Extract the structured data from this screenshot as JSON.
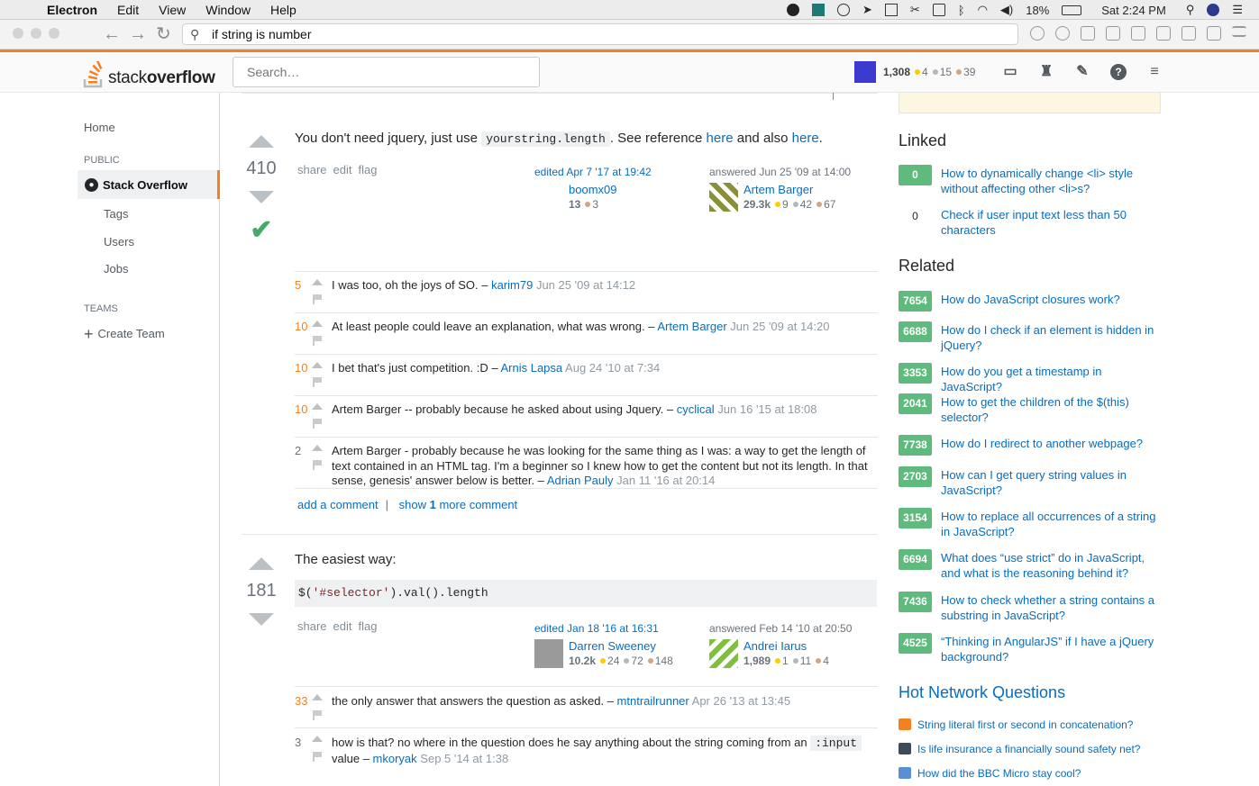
{
  "menubar": {
    "app": "Electron",
    "items": [
      "Edit",
      "View",
      "Window",
      "Help"
    ],
    "battery": "18%",
    "clock": "Sat 2:24 PM"
  },
  "browser": {
    "url": "if string is number"
  },
  "header": {
    "logo_light": "stack",
    "logo_bold": "overflow",
    "search_placeholder": "Search…",
    "reputation": "1,308",
    "gold": "4",
    "silver": "15",
    "bronze": "39"
  },
  "leftnav": {
    "home": "Home",
    "public_label": "PUBLIC",
    "stack_overflow": "Stack Overflow",
    "tags": "Tags",
    "users": "Users",
    "jobs": "Jobs",
    "teams_label": "TEAMS",
    "create_team": "Create Team"
  },
  "answers": [
    {
      "score": "410",
      "accepted": true,
      "body_pre": "You don't need jquery, just use",
      "body_code": "yourstring.length",
      "body_mid": ". See reference",
      "link1": "here",
      "body_and": "and also",
      "link2": "here",
      "body_end": ".",
      "menu": [
        "share",
        "edit",
        "flag"
      ],
      "edited": "edited Apr 7 '17 at 19:42",
      "editor": {
        "name": "boomx09",
        "rep": "13",
        "bronze": "3"
      },
      "answered": "answered Jun 25 '09 at 14:00",
      "author": {
        "name": "Artem Barger",
        "rep": "29.3k",
        "gold": "9",
        "silver": "42",
        "bronze": "67"
      },
      "comments": [
        {
          "score": "5",
          "text": "I was too, oh the joys of SO. –",
          "user": "karim79",
          "date": "Jun 25 '09 at 14:12"
        },
        {
          "score": "10",
          "text": "At least people could leave an explanation, what was wrong. –",
          "user": "Artem Barger",
          "date": "Jun 25 '09 at 14:20"
        },
        {
          "score": "10",
          "text": "I bet that's just competition. :D –",
          "user": "Arnis Lapsa",
          "date": "Aug 24 '10 at 7:34"
        },
        {
          "score": "10",
          "text": "Artem Barger -- probably because he asked about using Jquery. –",
          "user": "cyclical",
          "date": "Jun 16 '15 at 18:08"
        },
        {
          "score": "2",
          "text": "Artem Barger - probably because he was looking for the same thing as I was: a way to get the length of text contained in an HTML tag. I'm a beginner so I knew how to get the content but not its length. In that sense, genesis' answer below is better. –",
          "user": "Adrian Pauly",
          "date": "Jan 11 '16 at 20:14"
        }
      ],
      "add_comment": "add a comment",
      "show_more_pre": "show",
      "show_more_count": "1",
      "show_more_post": "more comment"
    },
    {
      "score": "181",
      "body": "The easiest way:",
      "code_pre": "$(",
      "code_str": "'#selector'",
      "code_post": ").val().length",
      "menu": [
        "share",
        "edit",
        "flag"
      ],
      "edited": "edited Jan 18 '16 at 16:31",
      "editor": {
        "name": "Darren Sweeney",
        "rep": "10.2k",
        "gold": "24",
        "silver": "72",
        "bronze": "148"
      },
      "answered": "answered Feb 14 '10 at 20:50",
      "author": {
        "name": "Andrei Iarus",
        "rep": "1,989",
        "gold": "1",
        "silver": "11",
        "bronze": "4"
      },
      "comments": [
        {
          "score": "33",
          "text": "the only answer that answers the question as asked. –",
          "user": "mtntrailrunner",
          "date": "Apr 26 '13 at 13:45"
        },
        {
          "score": "3",
          "text_pre": "how is that? no where in the question does he say anything about the string coming from an",
          "code": ":input",
          "text_post": "value –",
          "user": "mkoryak",
          "date": "Sep 5 '14 at 1:38"
        }
      ]
    }
  ],
  "sidebar": {
    "linked_title": "Linked",
    "linked": [
      {
        "count": "0",
        "title": "How to dynamically change <li> style without affecting other <li>s?"
      },
      {
        "count": "0",
        "title": "Check if user input text less than 50 characters"
      }
    ],
    "related_title": "Related",
    "related": [
      {
        "count": "7654",
        "title": "How do JavaScript closures work?"
      },
      {
        "count": "6688",
        "title": "How do I check if an element is hidden in jQuery?"
      },
      {
        "count": "3353",
        "title": "How do you get a timestamp in JavaScript?"
      },
      {
        "count": "2041",
        "title": "How to get the children of the $(this) selector?"
      },
      {
        "count": "7738",
        "title": "How do I redirect to another webpage?"
      },
      {
        "count": "2703",
        "title": "How can I get query string values in JavaScript?"
      },
      {
        "count": "3154",
        "title": "How to replace all occurrences of a string in JavaScript?"
      },
      {
        "count": "6694",
        "title": "What does “use strict” do in JavaScript, and what is the reasoning behind it?"
      },
      {
        "count": "7436",
        "title": "How to check whether a string contains a substring in JavaScript?"
      },
      {
        "count": "4525",
        "title": "“Thinking in AngularJS” if I have a jQuery background?"
      }
    ],
    "hot_title": "Hot Network Questions",
    "hot": [
      {
        "title": "String literal first or second in concatenation?",
        "color": "#f48024"
      },
      {
        "title": "Is life insurance a financially sound safety net?",
        "color": "#3d4a5c"
      },
      {
        "title": "How did the BBC Micro stay cool?",
        "color": "#5a8fd6"
      }
    ]
  },
  "colors": {
    "accent": "#f48024",
    "link": "#0a6cbd",
    "accepted": "#48a868",
    "badge": "#5fba7d"
  }
}
